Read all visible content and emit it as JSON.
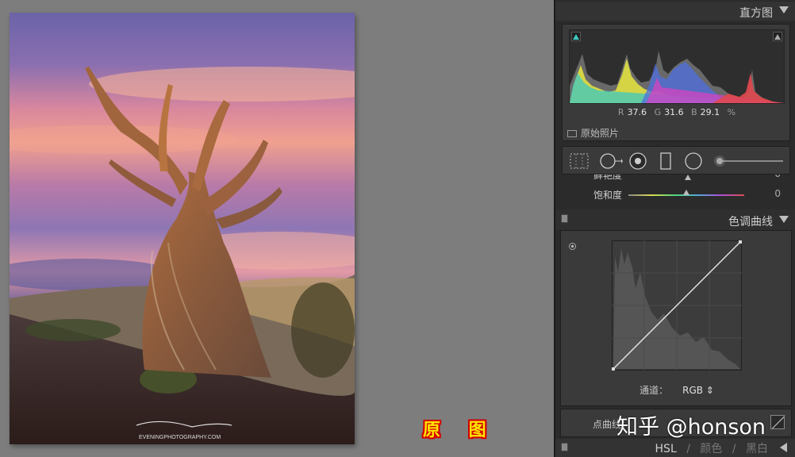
{
  "photo": {
    "signature_text": "EVENINGPHOTOGRAPHY.COM"
  },
  "caption": "原 图",
  "panel": {
    "histogram": {
      "title": "直方图",
      "readout": {
        "r_label": "R",
        "r_value": "37.6",
        "g_label": "G",
        "g_value": "31.6",
        "b_label": "B",
        "b_value": "29.1",
        "unit": "%"
      },
      "original_photo_label": "原始照片"
    },
    "tools": [
      "crop-overlay-icon",
      "spot-removal-icon",
      "red-eye-icon",
      "graduated-filter-icon",
      "radial-filter-icon",
      "adjustment-brush-icon"
    ],
    "sliders": [
      {
        "label": "鲜艳度",
        "value": "0",
        "thumb_fraction": 0.5
      },
      {
        "label": "饱和度",
        "value": "0",
        "thumb_fraction": 0.5
      }
    ],
    "tone_curve": {
      "title": "色调曲线",
      "channel_label": "通道：",
      "channel_value": "RGB ⇕",
      "point_curve_label": "点曲线：",
      "watermark": "知乎 @honson"
    },
    "hsl_header": {
      "hsl": "HSL",
      "sep": "/",
      "color": "颜色",
      "bw": "黑白"
    },
    "colors": {
      "panel_bg": "#2b2b2b",
      "canvas_bg": "#7d7d7d",
      "caption_fill": "#ffe600",
      "caption_outline": "#d30000"
    }
  }
}
